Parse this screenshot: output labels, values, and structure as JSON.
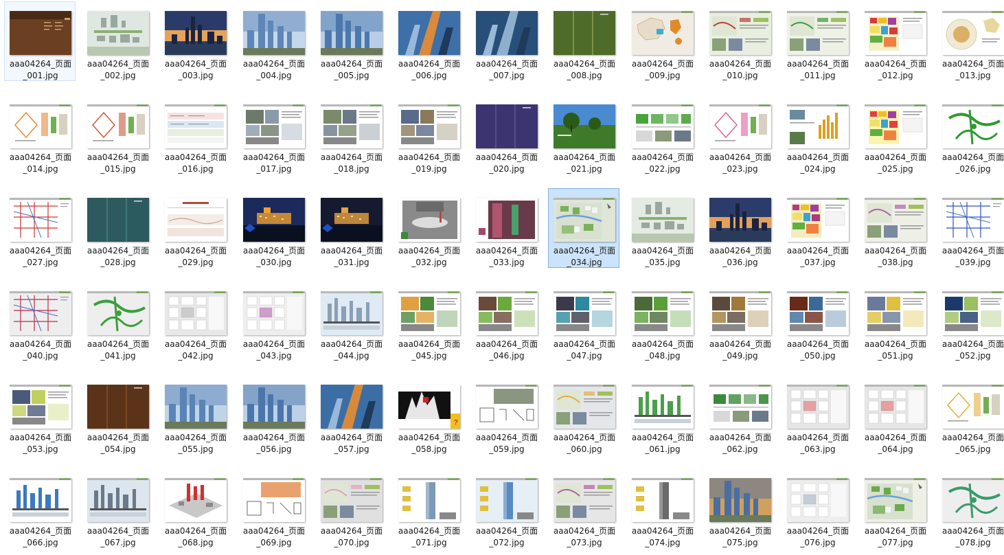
{
  "window": {
    "view": "large-icons",
    "selected": [
      "aaa04264_页面_034.jpg"
    ],
    "hover": [
      "aaa04264_页面_001.jpg"
    ]
  },
  "files": [
    {
      "name": "aaa04264_页面_001.jpg",
      "line1": "aaa04264_页面",
      "line2": "_001.jpg",
      "kind": "cover",
      "c": [
        "#6b3f22",
        "#c8a070"
      ]
    },
    {
      "name": "aaa04264_页面_002.jpg",
      "line1": "aaa04264_页面",
      "line2": "_002.jpg",
      "kind": "aerial",
      "c": [
        "#dfe8e0",
        "#9aa7a0"
      ]
    },
    {
      "name": "aaa04264_页面_003.jpg",
      "line1": "aaa04264_页面",
      "line2": "_003.jpg",
      "kind": "skyline",
      "c": [
        "#2a3b6a",
        "#e7a25a"
      ]
    },
    {
      "name": "aaa04264_页面_004.jpg",
      "line1": "aaa04264_页面",
      "line2": "_004.jpg",
      "kind": "towers",
      "c": [
        "#5e86b8",
        "#c5d7ea"
      ]
    },
    {
      "name": "aaa04264_页面_005.jpg",
      "line1": "aaa04264_页面",
      "line2": "_005.jpg",
      "kind": "towers",
      "c": [
        "#4c78ad",
        "#b8cee6"
      ]
    },
    {
      "name": "aaa04264_页面_006.jpg",
      "line1": "aaa04264_页面",
      "line2": "_006.jpg",
      "kind": "tilt",
      "c": [
        "#3d6fa8",
        "#d98a3c"
      ]
    },
    {
      "name": "aaa04264_页面_007.jpg",
      "line1": "aaa04264_页面",
      "line2": "_007.jpg",
      "kind": "tilt",
      "c": [
        "#274f7a",
        "#8fb0cc"
      ]
    },
    {
      "name": "aaa04264_页面_008.jpg",
      "line1": "aaa04264_页面",
      "line2": "_008.jpg",
      "kind": "stripes",
      "c": [
        "#4f6b2a",
        "#7a9346"
      ]
    },
    {
      "name": "aaa04264_页面_009.jpg",
      "line1": "aaa04264_页面",
      "line2": "_009.jpg",
      "kind": "map",
      "c": [
        "#f0ece4",
        "#e08a2a"
      ]
    },
    {
      "name": "aaa04264_页面_010.jpg",
      "line1": "aaa04264_页面",
      "line2": "_010.jpg",
      "kind": "plan",
      "c": [
        "#e8efe0",
        "#c03a3a"
      ]
    },
    {
      "name": "aaa04264_页面_011.jpg",
      "line1": "aaa04264_页面",
      "line2": "_011.jpg",
      "kind": "plan",
      "c": [
        "#eef2e6",
        "#3a9a3a"
      ]
    },
    {
      "name": "aaa04264_页面_012.jpg",
      "line1": "aaa04264_页面",
      "line2": "_012.jpg",
      "kind": "zoning",
      "c": [
        "#f4f0c8",
        "#d83a3a"
      ]
    },
    {
      "name": "aaa04264_页面_013.jpg",
      "line1": "aaa04264_页面",
      "line2": "_013.jpg",
      "kind": "circle",
      "c": [
        "#f1ead2",
        "#d6a04a"
      ]
    },
    {
      "name": "aaa04264_页面_014.jpg",
      "line1": "aaa04264_页面",
      "line2": "_014.jpg",
      "kind": "diagram",
      "c": [
        "#ffffff",
        "#e58a3a"
      ]
    },
    {
      "name": "aaa04264_页面_015.jpg",
      "line1": "aaa04264_页面",
      "line2": "_015.jpg",
      "kind": "diagram",
      "c": [
        "#ffffff",
        "#c85a3a"
      ]
    },
    {
      "name": "aaa04264_页面_016.jpg",
      "line1": "aaa04264_页面",
      "line2": "_016.jpg",
      "kind": "table",
      "c": [
        "#f6e2e2",
        "#d9e8f2"
      ]
    },
    {
      "name": "aaa04264_页面_017.jpg",
      "line1": "aaa04264_页面",
      "line2": "_017.jpg",
      "kind": "photos",
      "c": [
        "#6d7a6a",
        "#8a9aa8"
      ]
    },
    {
      "name": "aaa04264_页面_018.jpg",
      "line1": "aaa04264_页面",
      "line2": "_018.jpg",
      "kind": "photos",
      "c": [
        "#7a8a6a",
        "#6a7888"
      ]
    },
    {
      "name": "aaa04264_页面_019.jpg",
      "line1": "aaa04264_页面",
      "line2": "_019.jpg",
      "kind": "photos",
      "c": [
        "#5a6a8a",
        "#8a7a5a"
      ]
    },
    {
      "name": "aaa04264_页面_020.jpg",
      "line1": "aaa04264_页面",
      "line2": "_020.jpg",
      "kind": "stripes",
      "c": [
        "#3b3470",
        "#544d8c"
      ]
    },
    {
      "name": "aaa04264_页面_021.jpg",
      "line1": "aaa04264_页面",
      "line2": "_021.jpg",
      "kind": "park",
      "c": [
        "#4a8ad0",
        "#3e7a2a"
      ]
    },
    {
      "name": "aaa04264_页面_022.jpg",
      "line1": "aaa04264_页面",
      "line2": "_022.jpg",
      "kind": "boxes",
      "c": [
        "#ffffff",
        "#4aa33a"
      ]
    },
    {
      "name": "aaa04264_页面_023.jpg",
      "line1": "aaa04264_页面",
      "line2": "_023.jpg",
      "kind": "diagram",
      "c": [
        "#ffffff",
        "#e0609a"
      ]
    },
    {
      "name": "aaa04264_页面_024.jpg",
      "line1": "aaa04264_页面",
      "line2": "_024.jpg",
      "kind": "bars",
      "c": [
        "#ffffff",
        "#e0a020"
      ]
    },
    {
      "name": "aaa04264_页面_025.jpg",
      "line1": "aaa04264_页面",
      "line2": "_025.jpg",
      "kind": "zoning",
      "c": [
        "#fdf3b0",
        "#e04040"
      ]
    },
    {
      "name": "aaa04264_页面_026.jpg",
      "line1": "aaa04264_页面",
      "line2": "_026.jpg",
      "kind": "greennet",
      "c": [
        "#ffffff",
        "#2f9a2f"
      ]
    },
    {
      "name": "aaa04264_页面_027.jpg",
      "line1": "aaa04264_页面",
      "line2": "_027.jpg",
      "kind": "roads",
      "c": [
        "#ffffff",
        "#d03030"
      ]
    },
    {
      "name": "aaa04264_页面_028.jpg",
      "line1": "aaa04264_页面",
      "line2": "_028.jpg",
      "kind": "stripes",
      "c": [
        "#2d5a5e",
        "#43767a"
      ]
    },
    {
      "name": "aaa04264_页面_029.jpg",
      "line1": "aaa04264_页面",
      "line2": "_029.jpg",
      "kind": "text",
      "c": [
        "#f4ece6",
        "#b44a3a"
      ]
    },
    {
      "name": "aaa04264_页面_030.jpg",
      "line1": "aaa04264_页面",
      "line2": "_030.jpg",
      "kind": "night",
      "c": [
        "#1b2a5a",
        "#f0a030"
      ]
    },
    {
      "name": "aaa04264_页面_031.jpg",
      "line1": "aaa04264_页面",
      "line2": "_031.jpg",
      "kind": "night",
      "c": [
        "#151a30",
        "#e8a040"
      ]
    },
    {
      "name": "aaa04264_页面_032.jpg",
      "line1": "aaa04264_页面",
      "line2": "_032.jpg",
      "kind": "plaza",
      "c": [
        "#8a8a8a",
        "#c04040"
      ]
    },
    {
      "name": "aaa04264_页面_033.jpg",
      "line1": "aaa04264_页面",
      "line2": "_033.jpg",
      "kind": "street",
      "c": [
        "#6a3a4a",
        "#d06080"
      ]
    },
    {
      "name": "aaa04264_页面_034.jpg",
      "line1": "aaa04264_页面",
      "line2": "_034.jpg",
      "kind": "masterplan",
      "c": [
        "#dfe6d8",
        "#7ab05a"
      ]
    },
    {
      "name": "aaa04264_页面_035.jpg",
      "line1": "aaa04264_页面",
      "line2": "_035.jpg",
      "kind": "aerial",
      "c": [
        "#e4ebe2",
        "#9aa6a0"
      ]
    },
    {
      "name": "aaa04264_页面_036.jpg",
      "line1": "aaa04264_页面",
      "line2": "_036.jpg",
      "kind": "skyline",
      "c": [
        "#2c3c6a",
        "#e4a05a"
      ]
    },
    {
      "name": "aaa04264_页面_037.jpg",
      "line1": "aaa04264_页面",
      "line2": "_037.jpg",
      "kind": "zoning",
      "c": [
        "#f4ecc0",
        "#b03a7a"
      ]
    },
    {
      "name": "aaa04264_页面_038.jpg",
      "line1": "aaa04264_页面",
      "line2": "_038.jpg",
      "kind": "plan",
      "c": [
        "#eef0e6",
        "#b060b0"
      ]
    },
    {
      "name": "aaa04264_页面_039.jpg",
      "line1": "aaa04264_页面",
      "line2": "_039.jpg",
      "kind": "roads",
      "c": [
        "#ffffff",
        "#3050c0"
      ]
    },
    {
      "name": "aaa04264_页面_040.jpg",
      "line1": "aaa04264_页面",
      "line2": "_040.jpg",
      "kind": "roads",
      "c": [
        "#eeeeee",
        "#c02a4a"
      ]
    },
    {
      "name": "aaa04264_页面_041.jpg",
      "line1": "aaa04264_页面",
      "line2": "_041.jpg",
      "kind": "greennet",
      "c": [
        "#eeeeee",
        "#3aa03a"
      ]
    },
    {
      "name": "aaa04264_页面_042.jpg",
      "line1": "aaa04264_页面",
      "line2": "_042.jpg",
      "kind": "blocks",
      "c": [
        "#e8e8e8",
        "#9a9a9a"
      ]
    },
    {
      "name": "aaa04264_页面_043.jpg",
      "line1": "aaa04264_页面",
      "line2": "_043.jpg",
      "kind": "blocks",
      "c": [
        "#eeeeee",
        "#a0409a"
      ]
    },
    {
      "name": "aaa04264_页面_044.jpg",
      "line1": "aaa04264_页面",
      "line2": "_044.jpg",
      "kind": "section",
      "c": [
        "#dfeaf4",
        "#8aa0b4"
      ]
    },
    {
      "name": "aaa04264_页面_045.jpg",
      "line1": "aaa04264_页面",
      "line2": "_045.jpg",
      "kind": "photos",
      "c": [
        "#e0a040",
        "#4a8a3a"
      ]
    },
    {
      "name": "aaa04264_页面_046.jpg",
      "line1": "aaa04264_页面",
      "line2": "_046.jpg",
      "kind": "photos",
      "c": [
        "#6a4a3a",
        "#6aaa3a"
      ]
    },
    {
      "name": "aaa04264_页面_047.jpg",
      "line1": "aaa04264_页面",
      "line2": "_047.jpg",
      "kind": "photos",
      "c": [
        "#3a3a4a",
        "#2a8aa0"
      ]
    },
    {
      "name": "aaa04264_页面_048.jpg",
      "line1": "aaa04264_页面",
      "line2": "_048.jpg",
      "kind": "photos",
      "c": [
        "#4a6a3a",
        "#5aa03a"
      ]
    },
    {
      "name": "aaa04264_页面_049.jpg",
      "line1": "aaa04264_页面",
      "line2": "_049.jpg",
      "kind": "photos",
      "c": [
        "#5a4a3a",
        "#a07a3a"
      ]
    },
    {
      "name": "aaa04264_页面_050.jpg",
      "line1": "aaa04264_页面",
      "line2": "_050.jpg",
      "kind": "photos",
      "c": [
        "#6a2a1a",
        "#3a6a9a"
      ]
    },
    {
      "name": "aaa04264_页面_051.jpg",
      "line1": "aaa04264_页面",
      "line2": "_051.jpg",
      "kind": "photos",
      "c": [
        "#6a7a9a",
        "#e0c040"
      ]
    },
    {
      "name": "aaa04264_页面_052.jpg",
      "line1": "aaa04264_页面",
      "line2": "_052.jpg",
      "kind": "photos",
      "c": [
        "#1a3a6a",
        "#9ac060"
      ]
    },
    {
      "name": "aaa04264_页面_053.jpg",
      "line1": "aaa04264_页面",
      "line2": "_053.jpg",
      "kind": "photos",
      "c": [
        "#4a5a7a",
        "#c0d060"
      ]
    },
    {
      "name": "aaa04264_页面_054.jpg",
      "line1": "aaa04264_页面",
      "line2": "_054.jpg",
      "kind": "stripes",
      "c": [
        "#5a3318",
        "#7a4a28"
      ]
    },
    {
      "name": "aaa04264_页面_055.jpg",
      "line1": "aaa04264_页面",
      "line2": "_055.jpg",
      "kind": "towers",
      "c": [
        "#5a84b6",
        "#c0d4e8"
      ]
    },
    {
      "name": "aaa04264_页面_056.jpg",
      "line1": "aaa04264_页面",
      "line2": "_056.jpg",
      "kind": "towers",
      "c": [
        "#4a76ac",
        "#bcd0e6"
      ]
    },
    {
      "name": "aaa04264_页面_057.jpg",
      "line1": "aaa04264_页面",
      "line2": "_057.jpg",
      "kind": "tilt",
      "c": [
        "#3c6ea6",
        "#d88a3a"
      ]
    },
    {
      "name": "aaa04264_页面_058.jpg",
      "line1": "aaa04264_页面",
      "line2": "_058.jpg",
      "kind": "poster",
      "c": [
        "#111111",
        "#d02020"
      ]
    },
    {
      "name": "aaa04264_页面_059.jpg",
      "line1": "aaa04264_页面",
      "line2": "_059.jpg",
      "kind": "sketch",
      "c": [
        "#ffffff",
        "#5a6a4a"
      ]
    },
    {
      "name": "aaa04264_页面_060.jpg",
      "line1": "aaa04264_页面",
      "line2": "_060.jpg",
      "kind": "plan",
      "c": [
        "#e4e6ea",
        "#e0b040"
      ]
    },
    {
      "name": "aaa04264_页面_061.jpg",
      "line1": "aaa04264_页面",
      "line2": "_061.jpg",
      "kind": "section",
      "c": [
        "#ffffff",
        "#4aa04a"
      ]
    },
    {
      "name": "aaa04264_页面_062.jpg",
      "line1": "aaa04264_页面",
      "line2": "_062.jpg",
      "kind": "boxes",
      "c": [
        "#ffffff",
        "#3a8a3a"
      ]
    },
    {
      "name": "aaa04264_页面_063.jpg",
      "line1": "aaa04264_页面",
      "line2": "_063.jpg",
      "kind": "blocks",
      "c": [
        "#e6e6e6",
        "#d04040"
      ]
    },
    {
      "name": "aaa04264_页面_064.jpg",
      "line1": "aaa04264_页面",
      "line2": "_064.jpg",
      "kind": "blocks",
      "c": [
        "#e6e6e6",
        "#d04040"
      ]
    },
    {
      "name": "aaa04264_页面_065.jpg",
      "line1": "aaa04264_页面",
      "line2": "_065.jpg",
      "kind": "diagram",
      "c": [
        "#ffffff",
        "#e0b040"
      ]
    },
    {
      "name": "aaa04264_页面_066.jpg",
      "line1": "aaa04264_页面",
      "line2": "_066.jpg",
      "kind": "section",
      "c": [
        "#ffffff",
        "#3a7ac0"
      ]
    },
    {
      "name": "aaa04264_页面_067.jpg",
      "line1": "aaa04264_页面",
      "line2": "_067.jpg",
      "kind": "section",
      "c": [
        "#dde6ee",
        "#6a7a8a"
      ]
    },
    {
      "name": "aaa04264_页面_068.jpg",
      "line1": "aaa04264_页面",
      "line2": "_068.jpg",
      "kind": "model",
      "c": [
        "#ffffff",
        "#d03030"
      ]
    },
    {
      "name": "aaa04264_页面_069.jpg",
      "line1": "aaa04264_页面",
      "line2": "_069.jpg",
      "kind": "sketch",
      "c": [
        "#ffffff",
        "#e07a30"
      ]
    },
    {
      "name": "aaa04264_页面_070.jpg",
      "line1": "aaa04264_页面",
      "line2": "_070.jpg",
      "kind": "plan",
      "c": [
        "#e0e0e0",
        "#e0a0c0"
      ]
    },
    {
      "name": "aaa04264_页面_071.jpg",
      "line1": "aaa04264_页面",
      "line2": "_071.jpg",
      "kind": "tower1",
      "c": [
        "#ffffff",
        "#7a9ab8"
      ]
    },
    {
      "name": "aaa04264_页面_072.jpg",
      "line1": "aaa04264_页面",
      "line2": "_072.jpg",
      "kind": "tower1",
      "c": [
        "#e6eef6",
        "#5a8ac0"
      ]
    },
    {
      "name": "aaa04264_页面_073.jpg",
      "line1": "aaa04264_页面",
      "line2": "_073.jpg",
      "kind": "plan",
      "c": [
        "#e6e6e6",
        "#b060a0"
      ]
    },
    {
      "name": "aaa04264_页面_074.jpg",
      "line1": "aaa04264_页面",
      "line2": "_074.jpg",
      "kind": "tower1",
      "c": [
        "#ffffff",
        "#6a6a6a"
      ]
    },
    {
      "name": "aaa04264_页面_075.jpg",
      "line1": "aaa04264_页面",
      "line2": "_075.jpg",
      "kind": "towers",
      "c": [
        "#4a6ea0",
        "#d0a060"
      ]
    },
    {
      "name": "aaa04264_页面_076.jpg",
      "line1": "aaa04264_页面",
      "line2": "_076.jpg",
      "kind": "blocks",
      "c": [
        "#eeeeee",
        "#8a9ab0"
      ]
    },
    {
      "name": "aaa04264_页面_077.jpg",
      "line1": "aaa04264_页面",
      "line2": "_077.jpg",
      "kind": "masterplan",
      "c": [
        "#eef0e6",
        "#6aaa4a"
      ]
    },
    {
      "name": "aaa04264_页面_078.jpg",
      "line1": "aaa04264_页面",
      "line2": "_078.jpg",
      "kind": "greennet",
      "c": [
        "#eeeeee",
        "#3a9a6a"
      ]
    }
  ]
}
